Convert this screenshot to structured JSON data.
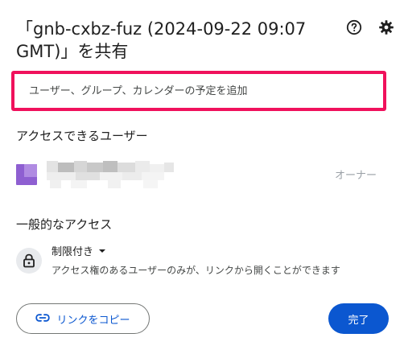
{
  "dialog": {
    "title": "「gnb-cxbz-fuz (2024-09-22 09:07 GMT)」を共有",
    "help_icon": "help-circle-icon",
    "settings_icon": "gear-icon"
  },
  "add_people": {
    "placeholder": "ユーザー、グループ、カレンダーの予定を追加",
    "highlight_color": "#f0115c"
  },
  "people_section": {
    "heading": "アクセスできるユーザー",
    "users": [
      {
        "avatar_color": "#8e5fd1",
        "name": "",
        "role": "オーナー"
      }
    ]
  },
  "general_access": {
    "heading": "一般的なアクセス",
    "icon": "lock-icon",
    "selected_value": "制限付き",
    "description": "アクセス権のあるユーザーのみが、リンクから開くことができます"
  },
  "footer": {
    "copy_link_label": "リンクをコピー",
    "copy_link_icon": "link-icon",
    "done_label": "完了",
    "accent_color": "#0b57d0"
  }
}
